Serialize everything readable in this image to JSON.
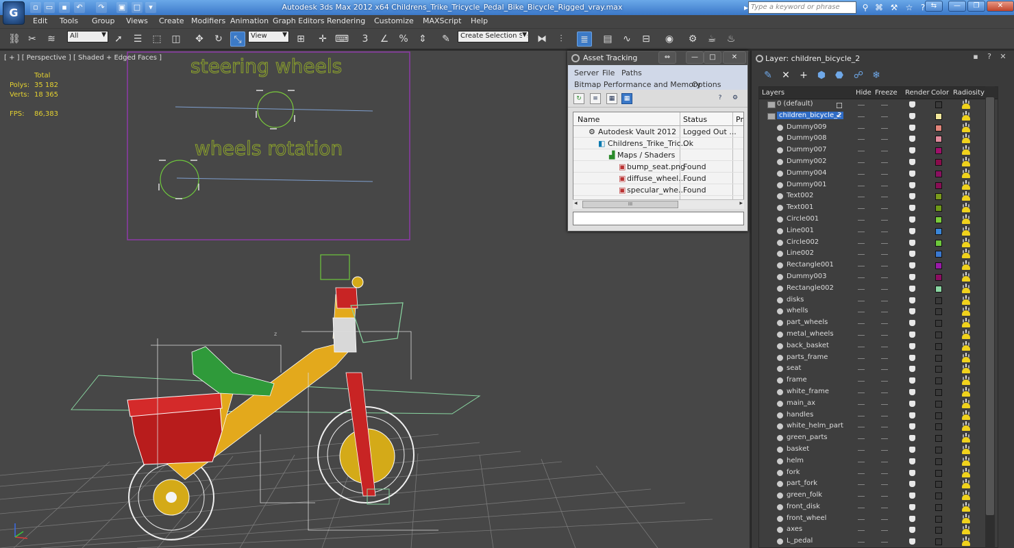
{
  "window": {
    "title": "Autodesk 3ds Max  2012 x64     Childrens_Trike_Tricycle_Pedal_Bike_Bicycle_Rigged_vray.max",
    "search_placeholder": "Type a keyword or phrase",
    "logo_text": "G"
  },
  "menu": [
    "Edit",
    "Tools",
    "Group",
    "Views",
    "Create",
    "Modifiers",
    "Animation",
    "Graph Editors",
    "Rendering",
    "Customize",
    "MAXScript",
    "Help"
  ],
  "toolbar": {
    "filter_value": "All",
    "coord_value": "View",
    "selection_set_placeholder": "Create Selection Se"
  },
  "viewport": {
    "label": "[ + ] [ Perspective ] [ Shaded + Edged Faces ]",
    "stats_header": "Total",
    "polys_label": "Polys:",
    "polys_value": "35 182",
    "verts_label": "Verts:",
    "verts_value": "18 365",
    "fps_label": "FPS:",
    "fps_value": "86,383",
    "text_steering": "steering wheels",
    "text_wheels": "wheels rotation",
    "axis_label": "z"
  },
  "asset_tracking": {
    "title": "Asset Tracking",
    "menu_row1": [
      "Server",
      "File",
      "Paths"
    ],
    "menu_row2": [
      "Bitmap Performance and Memory",
      "Options"
    ],
    "col_name": "Name",
    "col_status": "Status",
    "col_extra": "Pr",
    "rows": [
      {
        "name": "Autodesk Vault 2012",
        "status": "Logged Out ..."
      },
      {
        "name": "Childrens_Trike_Tric...",
        "status": "Ok"
      },
      {
        "name": "Maps / Shaders",
        "status": ""
      },
      {
        "name": "bump_seat.png",
        "status": "Found"
      },
      {
        "name": "diffuse_wheel...",
        "status": "Found"
      },
      {
        "name": "specular_whe...",
        "status": "Found"
      }
    ],
    "scroll_grip": "III"
  },
  "layer_panel": {
    "title": "Layer: children_bicycle_2",
    "columns": [
      "Layers",
      "Hide",
      "Freeze",
      "Render",
      "Color",
      "Radiosity"
    ],
    "rows": [
      {
        "name": "0 (default)",
        "kind": "layer",
        "color": "#3a3a3a"
      },
      {
        "name": "children_bicycle_2",
        "kind": "layer",
        "color": "#f2e79a",
        "selected": true
      },
      {
        "name": "Dummy009",
        "kind": "object",
        "color": "#e2857a"
      },
      {
        "name": "Dummy008",
        "kind": "object",
        "color": "#e28a9c"
      },
      {
        "name": "Dummy007",
        "kind": "object",
        "color": "#a0106a"
      },
      {
        "name": "Dummy002",
        "kind": "object",
        "color": "#8a0c4c"
      },
      {
        "name": "Dummy004",
        "kind": "object",
        "color": "#8a1060"
      },
      {
        "name": "Dummy001",
        "kind": "object",
        "color": "#880e54"
      },
      {
        "name": "Text002",
        "kind": "object",
        "color": "#7a9a1c"
      },
      {
        "name": "Text001",
        "kind": "object",
        "color": "#6f9a18"
      },
      {
        "name": "Circle001",
        "kind": "object",
        "color": "#7acc3a"
      },
      {
        "name": "Line001",
        "kind": "object",
        "color": "#3a86d8"
      },
      {
        "name": "Circle002",
        "kind": "object",
        "color": "#6ec83c"
      },
      {
        "name": "Line002",
        "kind": "object",
        "color": "#3a78d0"
      },
      {
        "name": "Rectangle001",
        "kind": "object",
        "color": "#9a1aa8"
      },
      {
        "name": "Dummy003",
        "kind": "object",
        "color": "#8c0e62"
      },
      {
        "name": "Rectangle002",
        "kind": "object",
        "color": "#8ad8a2"
      },
      {
        "name": "disks",
        "kind": "object",
        "color": "#3a3a3a"
      },
      {
        "name": "whells",
        "kind": "object",
        "color": "#3a3a3a"
      },
      {
        "name": "part_wheels",
        "kind": "object",
        "color": "#3a3a3a"
      },
      {
        "name": "metal_wheels",
        "kind": "object",
        "color": "#3a3a3a"
      },
      {
        "name": "back_basket",
        "kind": "object",
        "color": "#3a3a3a"
      },
      {
        "name": "parts_frame",
        "kind": "object",
        "color": "#3a3a3a"
      },
      {
        "name": "seat",
        "kind": "object",
        "color": "#3a3a3a"
      },
      {
        "name": "frame",
        "kind": "object",
        "color": "#3a3a3a"
      },
      {
        "name": "white_frame",
        "kind": "object",
        "color": "#3a3a3a"
      },
      {
        "name": "main_ax",
        "kind": "object",
        "color": "#3a3a3a"
      },
      {
        "name": "handles",
        "kind": "object",
        "color": "#3a3a3a"
      },
      {
        "name": "white_helm_part",
        "kind": "object",
        "color": "#3a3a3a"
      },
      {
        "name": "green_parts",
        "kind": "object",
        "color": "#3a3a3a"
      },
      {
        "name": "basket",
        "kind": "object",
        "color": "#3a3a3a"
      },
      {
        "name": "helm",
        "kind": "object",
        "color": "#3a3a3a"
      },
      {
        "name": "fork",
        "kind": "object",
        "color": "#3a3a3a"
      },
      {
        "name": "part_fork",
        "kind": "object",
        "color": "#3a3a3a"
      },
      {
        "name": "green_folk",
        "kind": "object",
        "color": "#3a3a3a"
      },
      {
        "name": "front_disk",
        "kind": "object",
        "color": "#3a3a3a"
      },
      {
        "name": "front_wheel",
        "kind": "object",
        "color": "#3a3a3a"
      },
      {
        "name": "axes",
        "kind": "object",
        "color": "#3a3a3a"
      },
      {
        "name": "L_pedal",
        "kind": "object",
        "color": "#3a3a3a"
      }
    ]
  }
}
